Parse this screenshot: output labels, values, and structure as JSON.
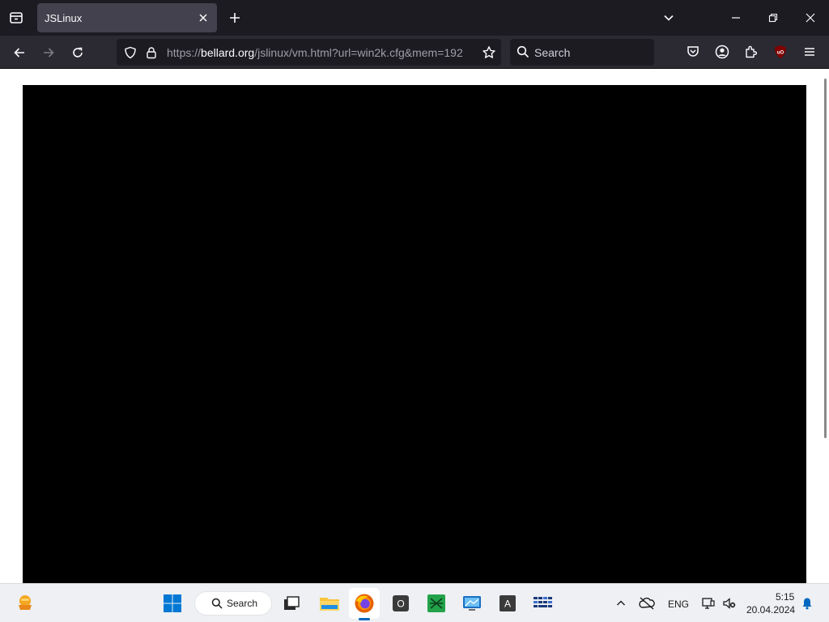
{
  "browser": {
    "tab": {
      "title": "JSLinux"
    },
    "url": {
      "scheme": "https://",
      "host": "bellard.org",
      "path": "/jslinux/vm.html?url=win2k.cfg&mem=192"
    },
    "search_placeholder": "Search",
    "icons": [
      "list-all-tabs-icon",
      "close-tab-icon",
      "new-tab-icon",
      "tab-list-dropdown-icon",
      "minimize-icon",
      "restore-icon",
      "close-window-icon",
      "back-icon",
      "forward-icon",
      "reload-icon",
      "tracking-protection-shield-icon",
      "lock-icon",
      "bookmark-star-icon",
      "search-icon",
      "pocket-icon",
      "account-icon",
      "extensions-icon",
      "ublock-origin-icon",
      "menu-icon"
    ]
  },
  "taskbar": {
    "search_label": "Search",
    "apps": [
      "start-button",
      "task-view",
      "file-explorer",
      "firefox",
      "obs",
      "xbox-app",
      "remote-desktop",
      "font-viewer",
      "keyboard-app"
    ],
    "tray": {
      "language": "ENG",
      "time": "5:15",
      "date": "20.04.2024"
    }
  },
  "colors": {
    "chrome_dark": "#1c1b22",
    "toolbar": "#2b2a33",
    "tab_active": "#42414d",
    "vm_screen": "#000000",
    "taskbar": "#eef0f3",
    "accent": "#0067c0"
  }
}
